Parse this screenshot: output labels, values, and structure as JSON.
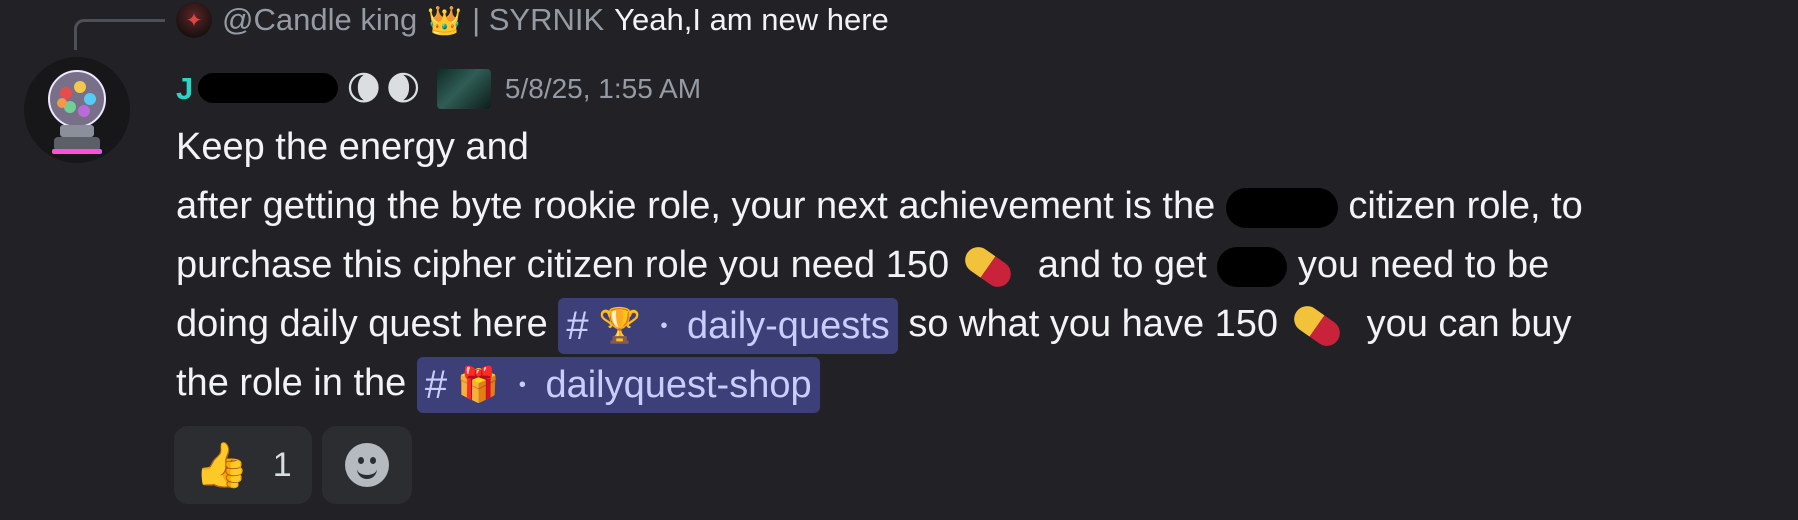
{
  "reply": {
    "author": "@Candle king",
    "crown_emoji": "👑",
    "server_tag": "| SYRNIK",
    "text": "Yeah,I am new here"
  },
  "message": {
    "username_visible_char": "J",
    "moons": "🌘🌒",
    "timestamp": "5/8/25, 1:55 AM",
    "lines": {
      "l1": "Keep the energy and",
      "l2a": "after getting the byte rookie role, your next achievement is the",
      "l2b": "citizen role, to",
      "l3a": "purchase this cipher citizen role you need 150",
      "l3b": "and to get",
      "l3c": "you need to be",
      "l4a": "doing daily quest here",
      "l4b": "so what you have 150",
      "l4c": "you can buy",
      "l5a": "the role in the"
    },
    "channels": {
      "daily_quests": {
        "hash": "#",
        "emoji": "🏆",
        "dot": "・",
        "name": "daily-quests"
      },
      "dailyquest_shop": {
        "hash": "#",
        "emoji": "🎁",
        "dot": "・",
        "name": "dailyquest-shop"
      }
    }
  },
  "reactions": [
    {
      "emoji": "👍",
      "count": "1"
    }
  ],
  "colors": {
    "background": "#222226",
    "mention_bg": "#3c3f78",
    "mention_text": "#c9cdfb",
    "username": "#2dd4c4",
    "muted": "#949ba4"
  },
  "icons": [
    "reply-connector",
    "pill-icon",
    "add-reaction-icon"
  ]
}
